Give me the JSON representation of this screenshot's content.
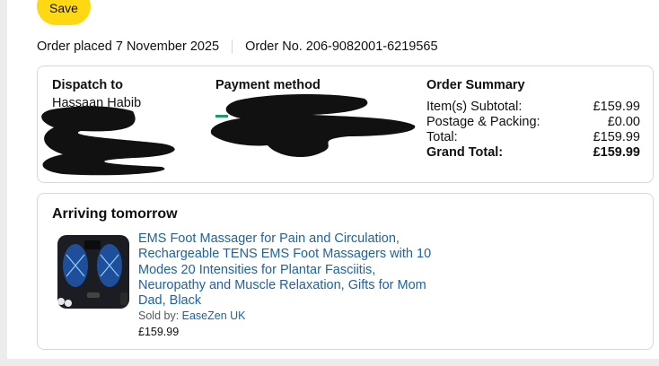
{
  "header": {
    "save_label": "Save"
  },
  "order": {
    "placed": "Order placed 7 November 2025",
    "number": "Order No. 206-9082001-6219565"
  },
  "dispatch": {
    "heading": "Dispatch to",
    "name": "Hassaan Habib"
  },
  "payment": {
    "heading": "Payment method"
  },
  "summary": {
    "heading": "Order Summary",
    "rows": [
      {
        "label": "Item(s) Subtotal:",
        "value": "£159.99"
      },
      {
        "label": "Postage & Packing:",
        "value": "£0.00"
      },
      {
        "label": "Total:",
        "value": "£159.99"
      },
      {
        "label": "Grand Total:",
        "value": "£159.99"
      }
    ]
  },
  "shipment": {
    "status": "Arriving tomorrow",
    "item": {
      "title": "EMS Foot Massager for Pain and Circulation, Rechargeable TENS EMS Foot Massagers with 10 Modes 20 Intensities for Plantar Fasciitis, Neuropathy and Muscle Relaxation, Gifts for Mom Dad, Black",
      "sold_by_label": "Sold by: ",
      "seller": "EaseZen UK",
      "price": "£159.99",
      "image_icon": "foot-massager-product-image"
    }
  },
  "colors": {
    "accent": "#ffd814",
    "link": "#2162a1",
    "border": "#d5d9d9",
    "redaction": "#111111"
  }
}
